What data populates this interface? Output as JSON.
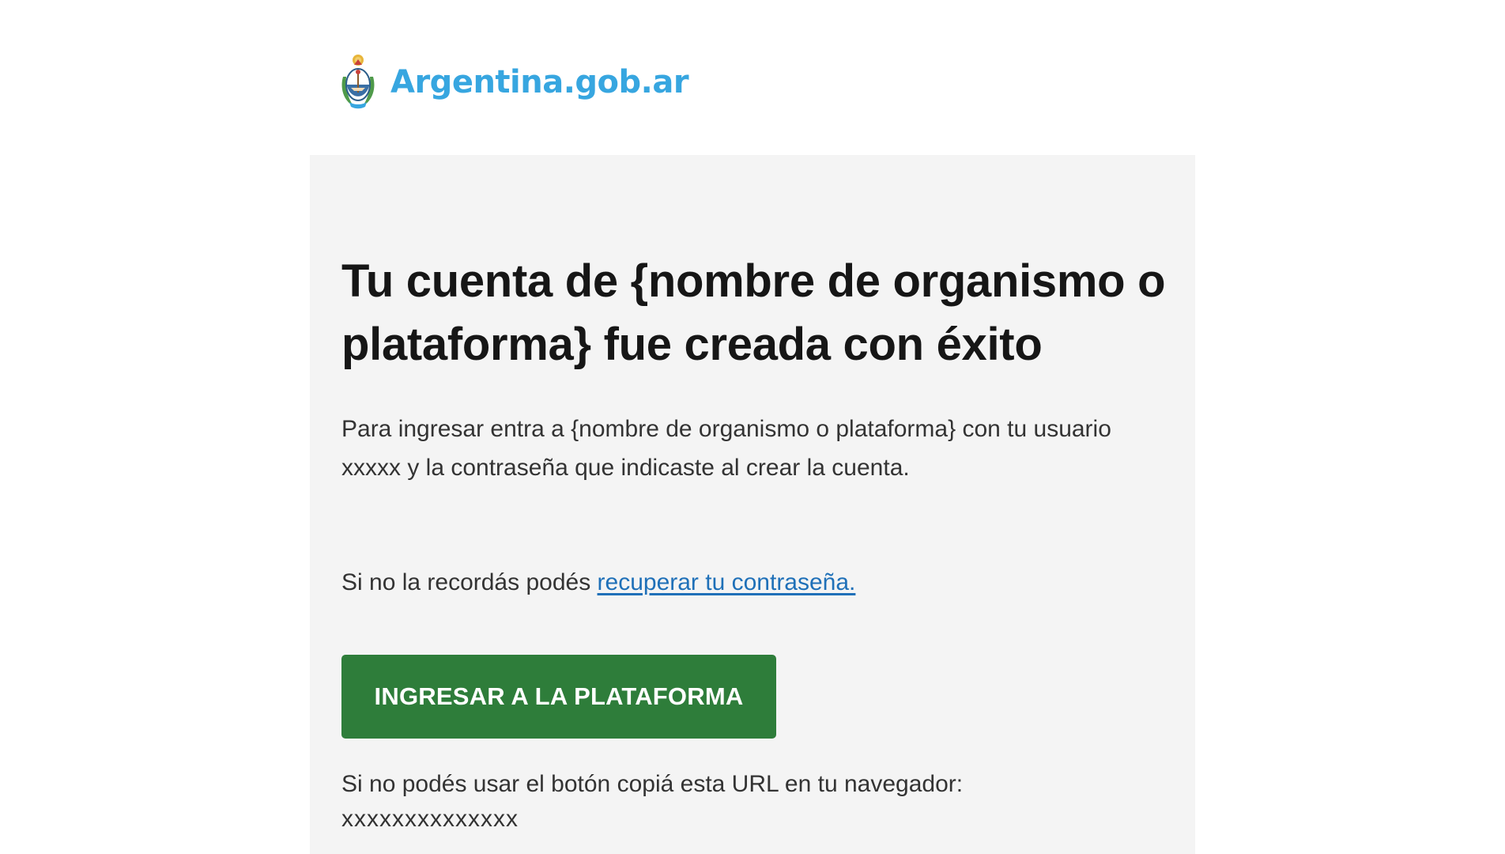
{
  "header": {
    "logo_text": "Argentina.gob.ar",
    "logo_icon": "argentina-coat-of-arms-icon"
  },
  "colors": {
    "brand_blue": "#37a6e0",
    "button_green": "#2e7d3a",
    "link_blue": "#1f70b8",
    "card_bg": "#f4f4f4"
  },
  "email": {
    "title": "Tu cuenta de {nombre de organismo o plataforma} fue creada con éxito",
    "intro": "Para ingresar entra a {nombre de organismo o plataforma} con tu usuario xxxxx y la contraseña que indicaste al crear la cuenta.",
    "recover_prefix": "Si no la recordás podés ",
    "recover_link": "recuperar tu contraseña.",
    "cta_label": "INGRESAR A LA PLATAFORMA",
    "fallback_text": "Si no podés usar el botón copiá esta URL en tu navegador:",
    "fallback_url": "xxxxxxxxxxxxxx"
  }
}
